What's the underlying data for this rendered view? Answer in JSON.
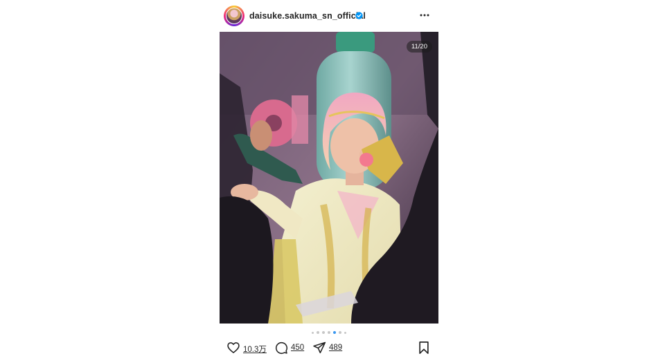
{
  "post": {
    "username": "daisuke.sakuma_sn_official",
    "verified": true,
    "slide_counter": "11/20",
    "carousel": {
      "total_dots": 7,
      "active_dot": 4
    },
    "actions": {
      "likes": "10.3万",
      "comments": "450",
      "shares": "489"
    }
  },
  "icons": {
    "avatar": "profile-avatar",
    "verified": "verified-badge-icon",
    "more": "more-options-icon",
    "like": "heart-icon",
    "comment": "comment-bubble-icon",
    "share": "paper-plane-icon",
    "save": "bookmark-icon"
  },
  "colors": {
    "accent": "#3897f0",
    "verified": "#0095f6",
    "text": "#262626"
  }
}
